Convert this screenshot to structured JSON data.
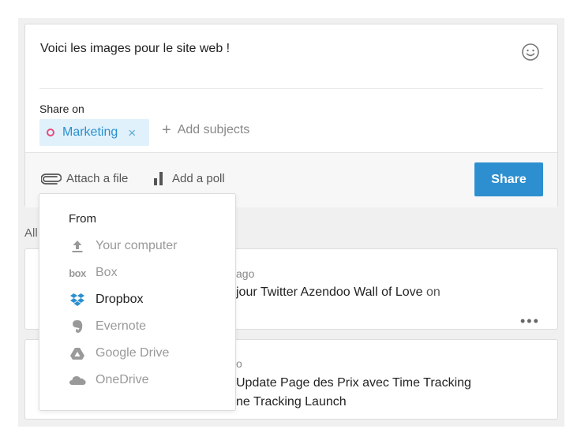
{
  "composer": {
    "message": "Voici les images pour le site web !",
    "share_on_label": "Share on",
    "subject_chip": "Marketing",
    "chip_remove": "×",
    "add_subjects": "Add subjects",
    "add_symbol": "+",
    "attach_label": "Attach a file",
    "poll_label": "Add a poll",
    "share_button": "Share"
  },
  "feed": {
    "section_label": "All",
    "posts": [
      {
        "time_fragment": "ago",
        "title_fragment": "jour Twitter Azendoo Wall of Love",
        "title_suffix": " on",
        "more": "•••"
      },
      {
        "time_fragment": "o",
        "title_fragment": "Update Page des Prix avec Time Tracking",
        "subtitle_fragment": "ne Tracking Launch"
      }
    ]
  },
  "attach_menu": {
    "title": "From",
    "items": [
      {
        "label": "Your computer",
        "icon": "upload-icon",
        "active": false
      },
      {
        "label": "Box",
        "icon": "box-icon",
        "active": false
      },
      {
        "label": "Dropbox",
        "icon": "dropbox-icon",
        "active": true
      },
      {
        "label": "Evernote",
        "icon": "evernote-icon",
        "active": false
      },
      {
        "label": "Google Drive",
        "icon": "google-drive-icon",
        "active": false
      },
      {
        "label": "OneDrive",
        "icon": "onedrive-icon",
        "active": false
      }
    ],
    "box_wordmark": "box"
  },
  "colors": {
    "accent": "#2d8fd0",
    "chip_bg": "#e0f1fb",
    "chip_text": "#2a8fcf",
    "subject_dot": "#e94b7a",
    "dropbox_blue": "#2d8fd0"
  }
}
